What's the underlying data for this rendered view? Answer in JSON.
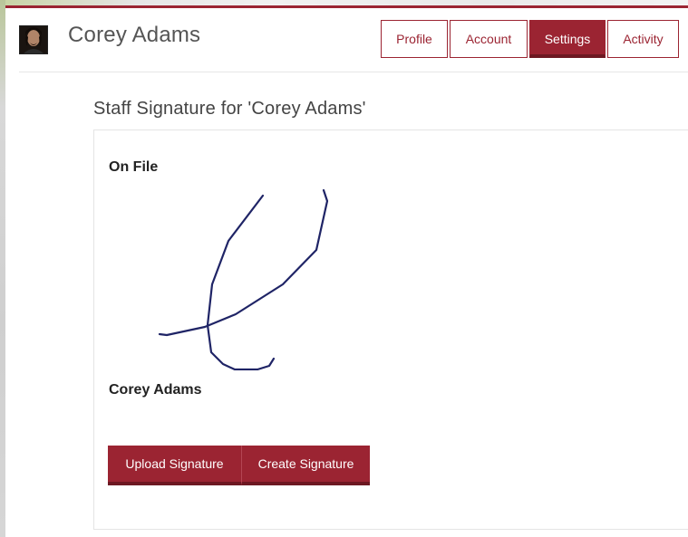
{
  "user": {
    "name": "Corey Adams",
    "avatar_icon": "user-avatar-photo"
  },
  "tabs": [
    {
      "label": "Profile",
      "active": false
    },
    {
      "label": "Account",
      "active": false
    },
    {
      "label": "Settings",
      "active": true
    },
    {
      "label": "Activity",
      "active": false
    }
  ],
  "section": {
    "title": "Staff Signature for 'Corey Adams'"
  },
  "signature": {
    "on_file_label": "On File",
    "signer_name": "Corey Adams",
    "ink_color": "#1f2466"
  },
  "actions": {
    "upload_label": "Upload Signature",
    "create_label": "Create Signature"
  },
  "colors": {
    "accent": "#9b2432",
    "accent_dark": "#6d1822"
  }
}
